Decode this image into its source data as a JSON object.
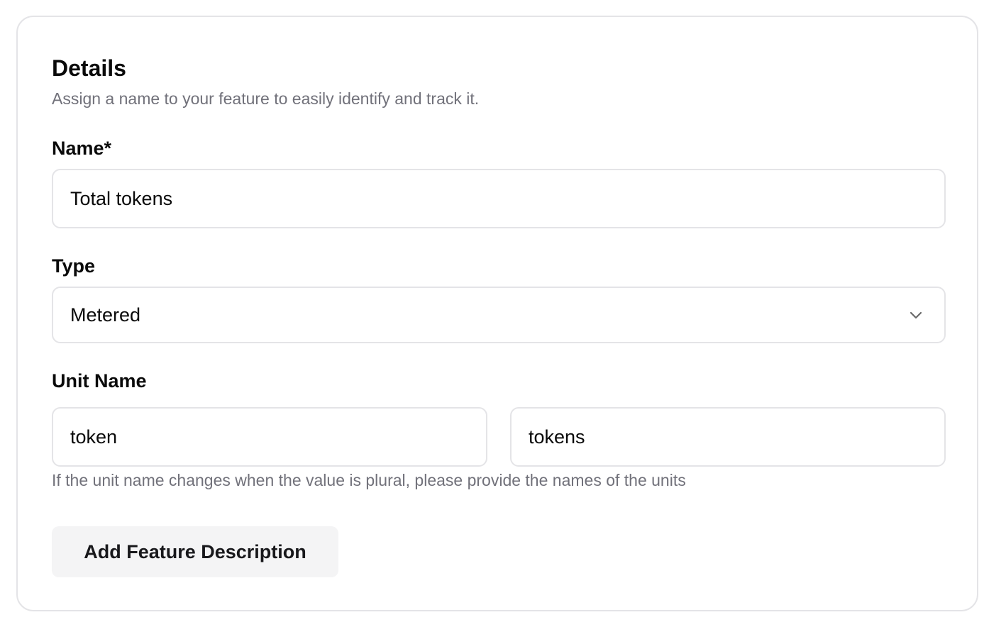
{
  "details": {
    "title": "Details",
    "description": "Assign a name to your feature to easily identify and track it."
  },
  "name_field": {
    "label": "Name*",
    "value": "Total tokens"
  },
  "type_field": {
    "label": "Type",
    "selected": "Metered",
    "icon": "chevron-down-icon"
  },
  "unit_field": {
    "label": "Unit Name",
    "singular_value": "token",
    "plural_value": "tokens",
    "helper": "If the unit name changes when the value is plural, please provide the names of the units"
  },
  "add_description_button": {
    "label": "Add Feature Description"
  },
  "colors": {
    "border": "#e4e4e7",
    "muted_text": "#71717a",
    "button_bg": "#f4f4f5"
  }
}
